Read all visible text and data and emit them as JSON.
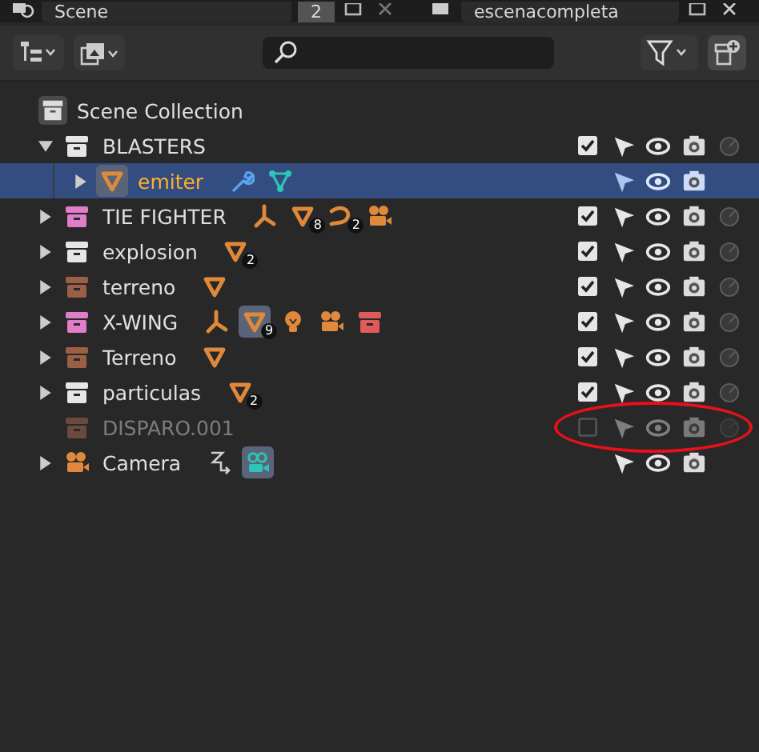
{
  "header": {
    "scene": "Scene",
    "users": "2",
    "view_layer": "escenacompleta"
  },
  "scene_collection": {
    "label": "Scene Collection",
    "children": [
      {
        "label": "BLASTERS",
        "kind": "collection",
        "color": "#e6e6e6",
        "expandable": true,
        "expanded": true,
        "selected": false,
        "active": false,
        "checked": true,
        "disabled": false,
        "circled": false,
        "children": [
          {
            "label": "emiter",
            "kind": "mesh",
            "expandable": true,
            "expanded": false,
            "selected": true,
            "active": true,
            "disabled": false,
            "circled": false,
            "extras": [
              {
                "kind": "wrench",
                "active": false
              },
              {
                "kind": "vertex_group",
                "active": false
              }
            ]
          }
        ]
      },
      {
        "label": "TIE FIGHTER",
        "kind": "collection",
        "color": "#e07cc8",
        "expandable": true,
        "expanded": false,
        "selected": false,
        "active": false,
        "checked": true,
        "disabled": false,
        "circled": false,
        "extras": [
          {
            "kind": "armature",
            "active": false
          },
          {
            "kind": "mesh",
            "count": "8",
            "active": false
          },
          {
            "kind": "curve",
            "count": "2",
            "active": false
          },
          {
            "kind": "camera",
            "active": false
          }
        ]
      },
      {
        "label": "explosion",
        "kind": "collection",
        "color": "#e6e6e6",
        "expandable": true,
        "expanded": false,
        "selected": false,
        "active": false,
        "checked": true,
        "disabled": false,
        "circled": false,
        "extras": [
          {
            "kind": "mesh",
            "count": "2",
            "active": false
          }
        ]
      },
      {
        "label": "terreno",
        "kind": "collection",
        "color": "#9a5f45",
        "expandable": true,
        "expanded": false,
        "selected": false,
        "active": false,
        "checked": true,
        "disabled": false,
        "circled": false,
        "extras": [
          {
            "kind": "mesh",
            "active": false
          }
        ]
      },
      {
        "label": "X-WING",
        "kind": "collection",
        "color": "#e07cc8",
        "expandable": true,
        "expanded": false,
        "selected": false,
        "active": false,
        "checked": true,
        "disabled": false,
        "circled": false,
        "extras": [
          {
            "kind": "armature",
            "active": false
          },
          {
            "kind": "mesh",
            "count": "9",
            "active": true
          },
          {
            "kind": "light",
            "active": false
          },
          {
            "kind": "camera",
            "active": false
          },
          {
            "kind": "collection",
            "active": false
          }
        ]
      },
      {
        "label": "Terreno",
        "kind": "collection",
        "color": "#9a5f45",
        "expandable": true,
        "expanded": false,
        "selected": false,
        "active": false,
        "checked": true,
        "disabled": false,
        "circled": false,
        "extras": [
          {
            "kind": "mesh",
            "active": false
          }
        ]
      },
      {
        "label": "particulas",
        "kind": "collection",
        "color": "#e6e6e6",
        "expandable": true,
        "expanded": false,
        "selected": false,
        "active": false,
        "checked": true,
        "disabled": false,
        "circled": false,
        "extras": [
          {
            "kind": "mesh",
            "count": "2",
            "active": false
          }
        ]
      },
      {
        "label": "DISPARO.001",
        "kind": "collection",
        "color": "#6b4a3e",
        "expandable": false,
        "expanded": false,
        "selected": false,
        "active": false,
        "checked": false,
        "disabled": true,
        "circled": true
      },
      {
        "label": "Camera",
        "kind": "camera",
        "expandable": true,
        "expanded": false,
        "selected": false,
        "active": false,
        "disabled": false,
        "circled": false,
        "extras": [
          {
            "kind": "constraint",
            "active": false
          },
          {
            "kind": "camera_data",
            "active": true
          }
        ]
      }
    ]
  }
}
